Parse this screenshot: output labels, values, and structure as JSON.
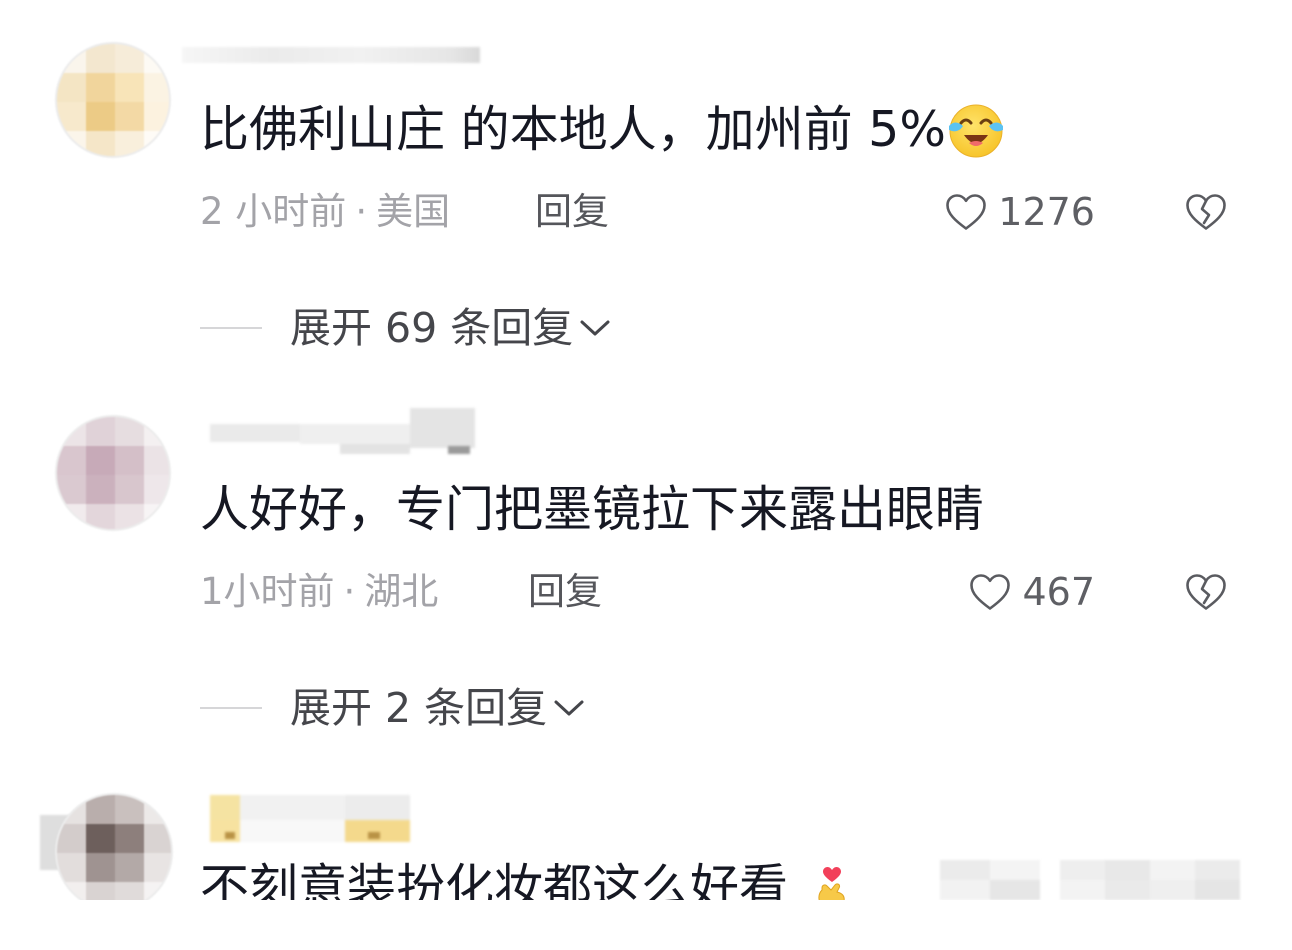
{
  "colors": {
    "text": "#161823",
    "meta": "#a3a3a8",
    "reply": "#55565b",
    "count": "#5e5f64",
    "expand": "#45464b",
    "divider": "#d6d6d8",
    "background": "#ffffff"
  },
  "icons": {
    "like": "heart-outline-icon",
    "dislike": "broken-heart-icon",
    "expand": "chevron-down-icon"
  },
  "comments": [
    {
      "text": "比佛利山庄 的本地人，加州前 5%",
      "emoji": "laugh-cry-emoji-icon",
      "time": "2 小时前",
      "separator": "·",
      "location": "美国",
      "reply_label": "回复",
      "likes": "1276",
      "expand_label": "展开 69 条回复"
    },
    {
      "text": "人好好，专门把墨镜拉下来露出眼睛",
      "time": "1小时前",
      "separator": "·",
      "location": "湖北",
      "reply_label": "回复",
      "likes": "467",
      "expand_label": "展开 2 条回复"
    },
    {
      "text": "不刻意装扮化妆都这么好看",
      "emoji": "finger-heart-emoji-icon"
    }
  ]
}
